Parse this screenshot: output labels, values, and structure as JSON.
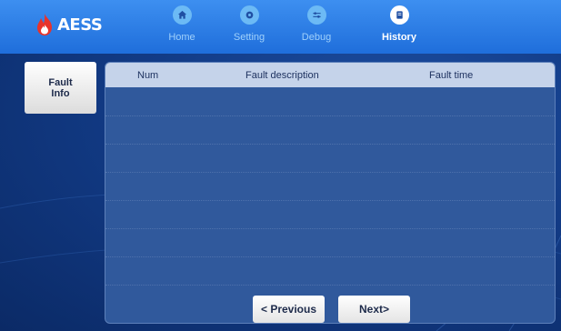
{
  "app": {
    "logo_text": "AESS"
  },
  "nav": {
    "items": [
      {
        "label": "Home",
        "icon": "home-icon"
      },
      {
        "label": "Setting",
        "icon": "gear-icon"
      },
      {
        "label": "Debug",
        "icon": "sliders-icon"
      },
      {
        "label": "History",
        "icon": "history-icon",
        "active": true
      }
    ]
  },
  "sidebar": {
    "fault_info_label": "Fault\nInfo"
  },
  "table": {
    "columns": [
      "Num",
      "Fault description",
      "Fault time"
    ],
    "rows": []
  },
  "pager": {
    "previous_label": "< Previous",
    "next_label": "Next>"
  },
  "colors": {
    "topbar": "#1f6edb",
    "background": "#0c2d6b",
    "panel": "#30599c",
    "header": "#c5d3ea",
    "logo_flame": "#e8332a"
  }
}
